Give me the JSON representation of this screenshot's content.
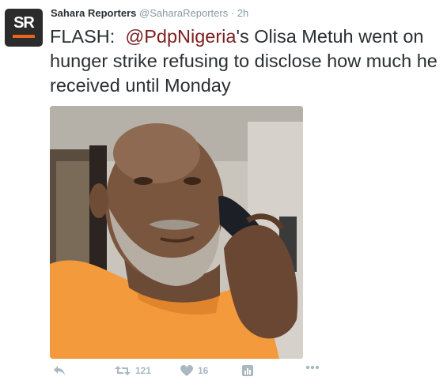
{
  "avatar": {
    "monogram": "SR",
    "bar_color": "#e8641b"
  },
  "tweet": {
    "author_name": "Sahara Reporters",
    "handle": "@SaharaReporters",
    "separator": "·",
    "time": "2h",
    "text_before": "FLASH:  ",
    "mention": "@PdpNigeria",
    "text_after": "'s Olisa Metuh went on hunger strike refusing to disclose how much he received until Monday"
  },
  "actions": {
    "reply_icon": "reply-icon",
    "retweet_icon": "retweet-icon",
    "retweet_count": "121",
    "like_icon": "heart-icon",
    "like_count": "16",
    "stats_icon": "analytics-icon",
    "more_icon": "more-icon"
  },
  "colors": {
    "text": "#292f33",
    "meta": "#8899a6",
    "mention": "#7a1e1e",
    "action": "#aab8c2"
  }
}
